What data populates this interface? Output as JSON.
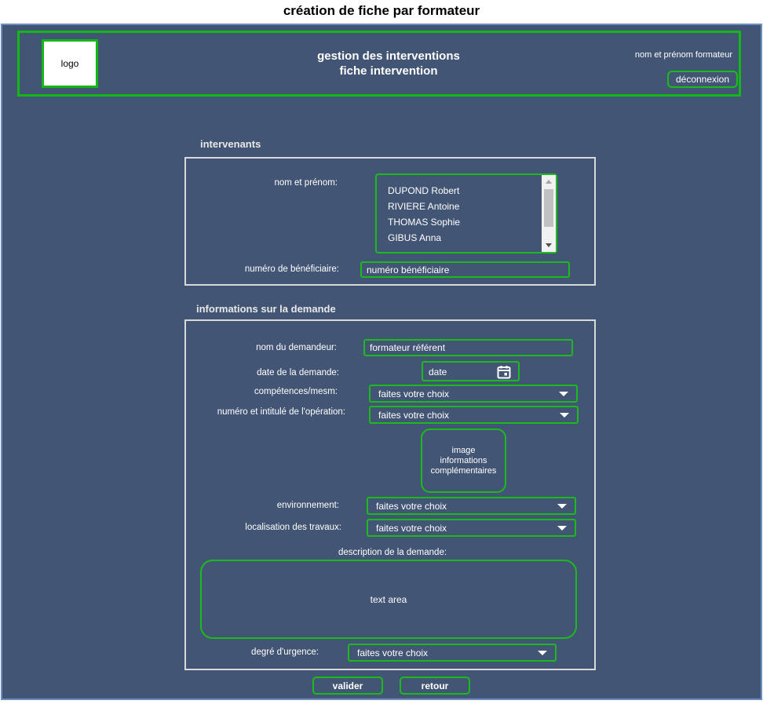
{
  "page_title": "création de fiche par formateur",
  "header": {
    "logo_text": "logo",
    "title_line1": "gestion des interventions",
    "title_line2": "fiche intervention",
    "user_label": "nom et prénom formateur",
    "logout_label": "déconnexion"
  },
  "intervenants": {
    "heading": "intervenants",
    "name_label": "nom et prénom:",
    "names": [
      "DUPOND Robert",
      "RIVIERE Antoine",
      "THOMAS Sophie",
      "GIBUS Anna"
    ],
    "beneficiary_label": "numéro de bénéficiaire:",
    "beneficiary_value": "numéro bénéficiaire"
  },
  "demande": {
    "heading": "informations sur la demande",
    "requester_label": "nom du demandeur:",
    "requester_value": "formateur référent",
    "date_label": "date de la demande:",
    "date_value": "date",
    "competences_label": "compétences/mesm:",
    "competences_value": "faites votre choix",
    "operation_label": "numéro et intitulé de l'opération:",
    "operation_value": "faites votre choix",
    "image_text_1": "image",
    "image_text_2": "informations",
    "image_text_3": "complémentaires",
    "environment_label": "environnement:",
    "environment_value": "faites votre choix",
    "location_label": "localisation des travaux:",
    "location_value": "faites votre choix",
    "description_label": "description de la demande:",
    "description_placeholder": "text area",
    "urgency_label": "degré d'urgence:",
    "urgency_value": "faites votre choix"
  },
  "actions": {
    "validate_label": "valider",
    "back_label": "retour"
  }
}
